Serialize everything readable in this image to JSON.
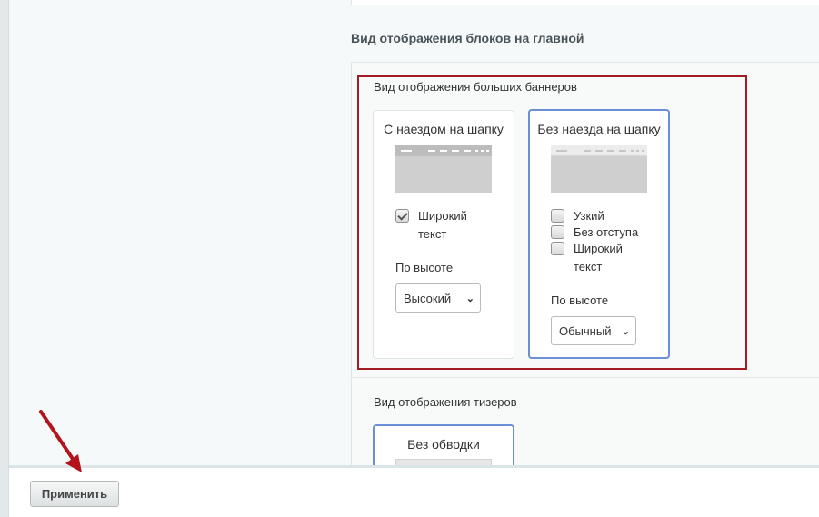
{
  "section": {
    "title": "Вид отображения блоков на главной"
  },
  "banners": {
    "label": "Вид отображения больших баннеров",
    "cards": [
      {
        "title": "С наездом на шапку",
        "checkbox": {
          "label": "Широкий текст",
          "checked": true
        },
        "height_label": "По высоте",
        "height_value": "Высокий"
      },
      {
        "title": "Без наезда на шапку",
        "checkboxes": [
          {
            "label": "Узкий",
            "checked": false
          },
          {
            "label": "Без отступа",
            "checked": false
          },
          {
            "label": "Широкий текст",
            "checked": false
          }
        ],
        "height_label": "По высоте",
        "height_value": "Обычный"
      }
    ]
  },
  "teasers": {
    "label": "Вид отображения тизеров",
    "cards": [
      {
        "title": "Без обводки"
      }
    ]
  },
  "footer": {
    "apply_label": "Применить"
  },
  "colors": {
    "highlight_frame": "#a31b24",
    "selected_border": "#6a8fd6",
    "arrow": "#b3141c"
  }
}
